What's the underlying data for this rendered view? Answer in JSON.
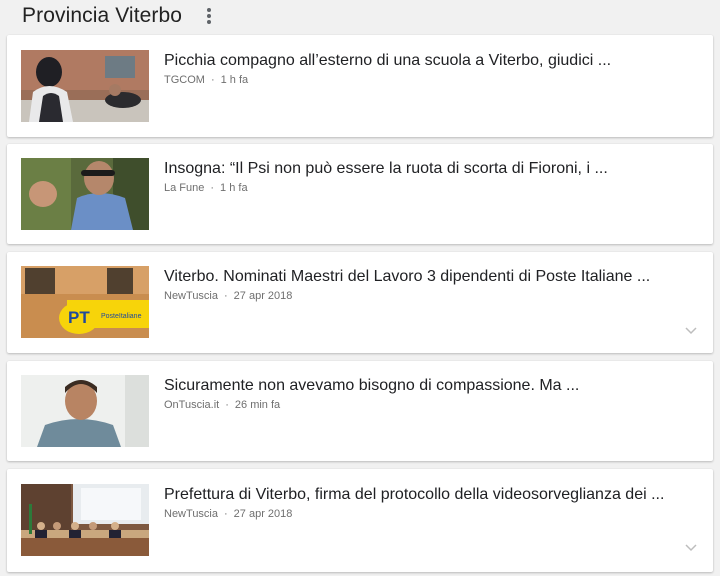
{
  "header": {
    "title": "Provincia Viterbo",
    "menu_icon": "more-vert-icon"
  },
  "articles": [
    {
      "headline": "Picchia compagno all’esterno di una scuola a Viterbo, giudici ...",
      "source": "TGCOM",
      "time": "1 h fa"
    },
    {
      "headline": "Insogna: “Il Psi non può essere la ruota di scorta di Fioroni, i ...",
      "source": "La Fune",
      "time": "1 h fa"
    },
    {
      "headline": "Viterbo. Nominati Maestri del Lavoro 3 dipendenti di Poste Italiane ...",
      "source": "NewTuscia",
      "time": "27 apr 2018",
      "thumb_logo": "PT",
      "thumb_brand": "PosteItaliane"
    },
    {
      "headline": "Sicuramente non avevamo bisogno di compassione. Ma ...",
      "source": "OnTuscia.it",
      "time": "26 min fa"
    },
    {
      "headline": "Prefettura di Viterbo, firma del protocollo della videosorveglianza dei ...",
      "source": "NewTuscia",
      "time": "27 apr 2018"
    }
  ],
  "colors": {
    "background": "#f1f1f1",
    "card": "#ffffff",
    "meta_text": "#6f6f6f",
    "poste_yellow": "#f7d40a",
    "poste_blue": "#1f4a9c"
  }
}
